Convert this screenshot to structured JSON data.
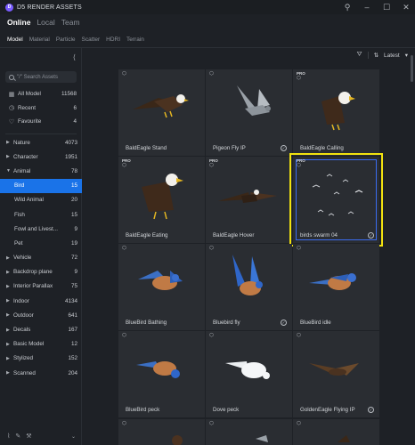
{
  "app": {
    "title": "D5 RENDER ASSETS"
  },
  "tabs": [
    "Online",
    "Local",
    "Team"
  ],
  "categories": [
    "Model",
    "Material",
    "Particle",
    "Scatter",
    "HDRI",
    "Terrain"
  ],
  "search": {
    "placeholder": "\"/\" Search Assets"
  },
  "nav_top": [
    {
      "label": "All Model",
      "count": "11568",
      "icon": "grid-icon"
    },
    {
      "label": "Recent",
      "count": "6",
      "icon": "clock-icon"
    },
    {
      "label": "Favourite",
      "count": "4",
      "icon": "heart-icon"
    }
  ],
  "tree": [
    {
      "label": "Nature",
      "count": "4073"
    },
    {
      "label": "Character",
      "count": "1951"
    },
    {
      "label": "Animal",
      "count": "78"
    },
    {
      "label": "Bird",
      "count": "15"
    },
    {
      "label": "Wild Animal",
      "count": "20"
    },
    {
      "label": "Fish",
      "count": "15"
    },
    {
      "label": "Fowl and Livest...",
      "count": "9"
    },
    {
      "label": "Pet",
      "count": "19"
    },
    {
      "label": "Vehicle",
      "count": "72"
    },
    {
      "label": "Backdrop plane",
      "count": "9"
    },
    {
      "label": "Interior Parallax",
      "count": "75"
    },
    {
      "label": "Indoor",
      "count": "4134"
    },
    {
      "label": "Outdoor",
      "count": "641"
    },
    {
      "label": "Decals",
      "count": "167"
    },
    {
      "label": "Basic Model",
      "count": "12"
    },
    {
      "label": "Stylized",
      "count": "152"
    },
    {
      "label": "Scanned",
      "count": "204"
    }
  ],
  "toolbar": {
    "sort_label": "Latest"
  },
  "assets": [
    {
      "name": "BaldEagle Stand",
      "pro": "",
      "check": ""
    },
    {
      "name": "Pigeon Fly IP",
      "pro": "",
      "check": "✓"
    },
    {
      "name": "BaldEagle Calling",
      "pro": "PRO",
      "check": ""
    },
    {
      "name": "BaldEagle Eating",
      "pro": "PRO",
      "check": ""
    },
    {
      "name": "BaldEagle Hover",
      "pro": "PRO",
      "check": ""
    },
    {
      "name": "birds swarm 04",
      "pro": "PRO",
      "check": "✓"
    },
    {
      "name": "BlueBird Bathing",
      "pro": "",
      "check": ""
    },
    {
      "name": "Bluebird fly",
      "pro": "",
      "check": "✓"
    },
    {
      "name": "BlueBird idle",
      "pro": "",
      "check": ""
    },
    {
      "name": "BlueBird peck",
      "pro": "",
      "check": ""
    },
    {
      "name": "Dove peck",
      "pro": "",
      "check": ""
    },
    {
      "name": "GoldenEagle Flying IP",
      "pro": "",
      "check": "✓"
    }
  ],
  "colors": {
    "selected": "#1a73e8",
    "highlight": "#f2e20f",
    "accent": "#7a5cff"
  }
}
